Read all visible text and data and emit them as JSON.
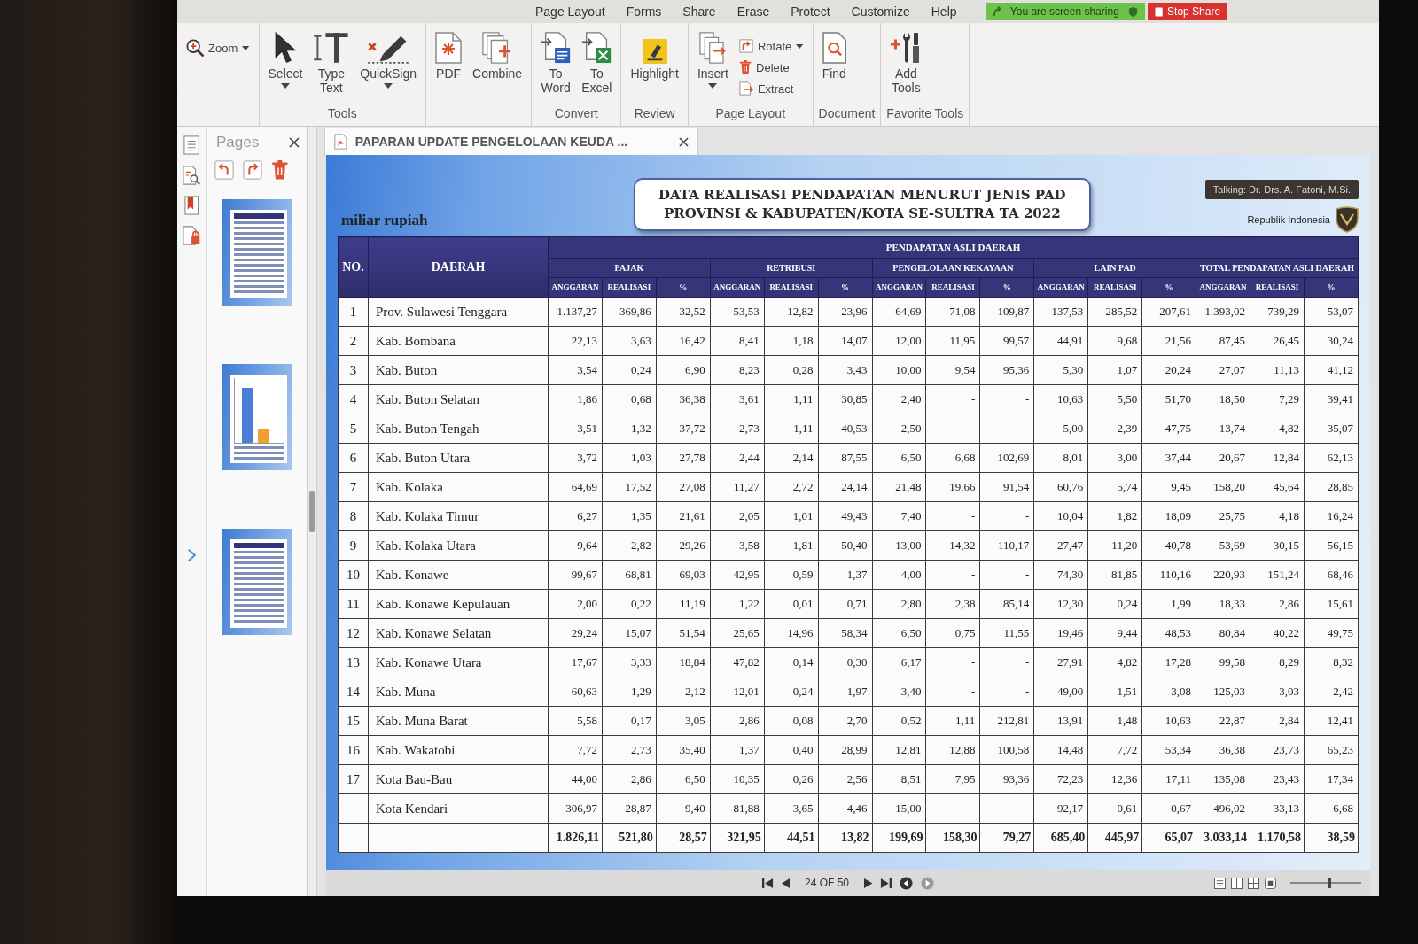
{
  "ribbon": {
    "tabs": [
      {
        "label": "Page Layout",
        "selected": false
      },
      {
        "label": "Forms",
        "selected": false
      },
      {
        "label": "Share",
        "selected": false
      },
      {
        "label": "Erase",
        "selected": false
      },
      {
        "label": "Protect",
        "selected": false
      },
      {
        "label": "Customize",
        "selected": false
      },
      {
        "label": "Help",
        "selected": false
      }
    ],
    "groups": [
      {
        "items": [
          {
            "kind": "zoom",
            "label": "Zoom",
            "menu": true
          }
        ]
      },
      {
        "label": "Tools",
        "items": [
          {
            "kind": "select",
            "label": "Select",
            "menu": true
          },
          {
            "kind": "type-text",
            "label": "Type Text",
            "menu": false
          },
          {
            "kind": "quicksign",
            "label": "QuickSign",
            "menu": true
          }
        ]
      },
      {
        "items": [
          {
            "kind": "pdf",
            "label": "PDF",
            "menu": false
          },
          {
            "kind": "combine",
            "label": "Combine",
            "menu": false
          }
        ]
      },
      {
        "label": "Convert",
        "items": [
          {
            "kind": "to-word",
            "label": "To Word",
            "menu": false
          },
          {
            "kind": "to-excel",
            "label": "To Excel",
            "menu": false
          }
        ]
      },
      {
        "label": "Review",
        "items": [
          {
            "kind": "highlight",
            "label": "Highlight",
            "menu": false
          }
        ]
      },
      {
        "label": "Page Layout",
        "items": [
          {
            "kind": "insert",
            "label": "Insert",
            "menu": true
          },
          {
            "kind": "rotate",
            "label": "Rotate",
            "menu": true
          },
          {
            "kind": "delete",
            "label": "Delete",
            "menu": false
          },
          {
            "kind": "extract",
            "label": "Extract",
            "menu": false
          }
        ]
      },
      {
        "label": "Document",
        "items": [
          {
            "kind": "find",
            "label": "Find",
            "menu": false
          }
        ]
      },
      {
        "label": "Favorite Tools",
        "items": [
          {
            "kind": "add-tools",
            "label": "Add Tools",
            "menu": false
          }
        ]
      }
    ]
  },
  "screen_share": {
    "status": "You are screen sharing",
    "stop_label": "Stop Share"
  },
  "pages_panel": {
    "title": "Pages",
    "thumbnails": [
      {
        "kind": "table"
      },
      {
        "kind": "chart"
      },
      {
        "kind": "table"
      }
    ]
  },
  "document": {
    "tab_title": "PAPARAN UPDATE PENGELOLAAN KEUDA ...",
    "speaker_label": "Talking: Dr. Drs. A. Fatoni, M.Si.",
    "slide": {
      "unit_label": "miliar rupiah",
      "title_lines": [
        "DATA REALISASI PENDAPATAN MENURUT JENIS PAD",
        "PROVINSI & KABUPATEN/KOTA SE-SULTRA TA 2022"
      ],
      "emblem_caption": "Republik Indonesia",
      "table": {
        "header": {
          "no": "NO.",
          "region": "DAERAH",
          "group": "PENDAPATAN ASLI DAERAH",
          "subgroups": [
            {
              "label": "PAJAK",
              "columns": [
                "ANGGARAN",
                "REALISASI",
                "%"
              ]
            },
            {
              "label": "RETRIBUSI",
              "columns": [
                "ANGGARAN",
                "REALISASI",
                "%"
              ]
            },
            {
              "label": "PENGELOLAAN KEKAYAAN",
              "columns": [
                "ANGGARAN",
                "REALISASI",
                "%"
              ]
            },
            {
              "label": "LAIN PAD",
              "columns": [
                "ANGGARAN",
                "REALISASI",
                "%"
              ]
            },
            {
              "label": "TOTAL PENDAPATAN ASLI DAERAH",
              "columns": [
                "ANGGARAN",
                "REALISASI",
                "%"
              ]
            }
          ]
        },
        "rows": [
          {
            "kind": "data",
            "no": "1",
            "region": "Prov. Sulawesi Tenggara",
            "values": [
              "1.137,27",
              "369,86",
              "32,52",
              "53,53",
              "12,82",
              "23,96",
              "64,69",
              "71,08",
              "109,87",
              "137,53",
              "285,52",
              "207,61",
              "1.393,02",
              "739,29",
              "53,07"
            ]
          },
          {
            "kind": "data",
            "no": "2",
            "region": "Kab. Bombana",
            "values": [
              "22,13",
              "3,63",
              "16,42",
              "8,41",
              "1,18",
              "14,07",
              "12,00",
              "11,95",
              "99,57",
              "44,91",
              "9,68",
              "21,56",
              "87,45",
              "26,45",
              "30,24"
            ]
          },
          {
            "kind": "data",
            "no": "3",
            "region": "Kab. Buton",
            "values": [
              "3,54",
              "0,24",
              "6,90",
              "8,23",
              "0,28",
              "3,43",
              "10,00",
              "9,54",
              "95,36",
              "5,30",
              "1,07",
              "20,24",
              "27,07",
              "11,13",
              "41,12"
            ]
          },
          {
            "kind": "data",
            "no": "4",
            "region": "Kab. Buton Selatan",
            "values": [
              "1,86",
              "0,68",
              "36,38",
              "3,61",
              "1,11",
              "30,85",
              "2,40",
              "-",
              "-",
              "10,63",
              "5,50",
              "51,70",
              "18,50",
              "7,29",
              "39,41"
            ]
          },
          {
            "kind": "data",
            "no": "5",
            "region": "Kab. Buton Tengah",
            "values": [
              "3,51",
              "1,32",
              "37,72",
              "2,73",
              "1,11",
              "40,53",
              "2,50",
              "-",
              "-",
              "5,00",
              "2,39",
              "47,75",
              "13,74",
              "4,82",
              "35,07"
            ]
          },
          {
            "kind": "data",
            "no": "6",
            "region": "Kab. Buton Utara",
            "values": [
              "3,72",
              "1,03",
              "27,78",
              "2,44",
              "2,14",
              "87,55",
              "6,50",
              "6,68",
              "102,69",
              "8,01",
              "3,00",
              "37,44",
              "20,67",
              "12,84",
              "62,13"
            ]
          },
          {
            "kind": "data",
            "no": "7",
            "region": "Kab. Kolaka",
            "values": [
              "64,69",
              "17,52",
              "27,08",
              "11,27",
              "2,72",
              "24,14",
              "21,48",
              "19,66",
              "91,54",
              "60,76",
              "5,74",
              "9,45",
              "158,20",
              "45,64",
              "28,85"
            ]
          },
          {
            "kind": "data",
            "no": "8",
            "region": "Kab. Kolaka Timur",
            "values": [
              "6,27",
              "1,35",
              "21,61",
              "2,05",
              "1,01",
              "49,43",
              "7,40",
              "-",
              "-",
              "10,04",
              "1,82",
              "18,09",
              "25,75",
              "4,18",
              "16,24"
            ]
          },
          {
            "kind": "data",
            "no": "9",
            "region": "Kab. Kolaka Utara",
            "values": [
              "9,64",
              "2,82",
              "29,26",
              "3,58",
              "1,81",
              "50,40",
              "13,00",
              "14,32",
              "110,17",
              "27,47",
              "11,20",
              "40,78",
              "53,69",
              "30,15",
              "56,15"
            ]
          },
          {
            "kind": "data",
            "no": "10",
            "region": "Kab. Konawe",
            "values": [
              "99,67",
              "68,81",
              "69,03",
              "42,95",
              "0,59",
              "1,37",
              "4,00",
              "-",
              "-",
              "74,30",
              "81,85",
              "110,16",
              "220,93",
              "151,24",
              "68,46"
            ]
          },
          {
            "kind": "data",
            "no": "11",
            "region": "Kab. Konawe Kepulauan",
            "values": [
              "2,00",
              "0,22",
              "11,19",
              "1,22",
              "0,01",
              "0,71",
              "2,80",
              "2,38",
              "85,14",
              "12,30",
              "0,24",
              "1,99",
              "18,33",
              "2,86",
              "15,61"
            ]
          },
          {
            "kind": "data",
            "no": "12",
            "region": "Kab. Konawe Selatan",
            "values": [
              "29,24",
              "15,07",
              "51,54",
              "25,65",
              "14,96",
              "58,34",
              "6,50",
              "0,75",
              "11,55",
              "19,46",
              "9,44",
              "48,53",
              "80,84",
              "40,22",
              "49,75"
            ]
          },
          {
            "kind": "data",
            "no": "13",
            "region": "Kab. Konawe Utara",
            "values": [
              "17,67",
              "3,33",
              "18,84",
              "47,82",
              "0,14",
              "0,30",
              "6,17",
              "-",
              "-",
              "27,91",
              "4,82",
              "17,28",
              "99,58",
              "8,29",
              "8,32"
            ]
          },
          {
            "kind": "data",
            "no": "14",
            "region": "Kab. Muna",
            "values": [
              "60,63",
              "1,29",
              "2,12",
              "12,01",
              "0,24",
              "1,97",
              "3,40",
              "-",
              "-",
              "49,00",
              "1,51",
              "3,08",
              "125,03",
              "3,03",
              "2,42"
            ]
          },
          {
            "kind": "data",
            "no": "15",
            "region": "Kab. Muna Barat",
            "values": [
              "5,58",
              "0,17",
              "3,05",
              "2,86",
              "0,08",
              "2,70",
              "0,52",
              "1,11",
              "212,81",
              "13,91",
              "1,48",
              "10,63",
              "22,87",
              "2,84",
              "12,41"
            ]
          },
          {
            "kind": "data",
            "no": "16",
            "region": "Kab. Wakatobi",
            "values": [
              "7,72",
              "2,73",
              "35,40",
              "1,37",
              "0,40",
              "28,99",
              "12,81",
              "12,88",
              "100,58",
              "14,48",
              "7,72",
              "53,34",
              "36,38",
              "23,73",
              "65,23"
            ]
          },
          {
            "kind": "data",
            "no": "17",
            "region": "Kota Bau-Bau",
            "values": [
              "44,00",
              "2,86",
              "6,50",
              "10,35",
              "0,26",
              "2,56",
              "8,51",
              "7,95",
              "93,36",
              "72,23",
              "12,36",
              "17,11",
              "135,08",
              "23,43",
              "17,34"
            ]
          },
          {
            "kind": "data",
            "region": "Kota Kendari",
            "values": [
              "306,97",
              "28,87",
              "9,40",
              "81,88",
              "3,65",
              "4,46",
              "15,00",
              "-",
              "-",
              "92,17",
              "0,61",
              "0,67",
              "496,02",
              "33,13",
              "6,68"
            ]
          },
          {
            "kind": "total",
            "values": [
              "1.826,11",
              "521,80",
              "28,57",
              "321,95",
              "44,51",
              "13,82",
              "199,69",
              "158,30",
              "79,27",
              "685,40",
              "445,97",
              "65,07",
              "3.033,14",
              "1.170,58",
              "38,59"
            ]
          }
        ]
      }
    },
    "navigation": {
      "page_indicator": "24 OF 50",
      "zoom_slider": {
        "level": 0.55
      }
    }
  }
}
